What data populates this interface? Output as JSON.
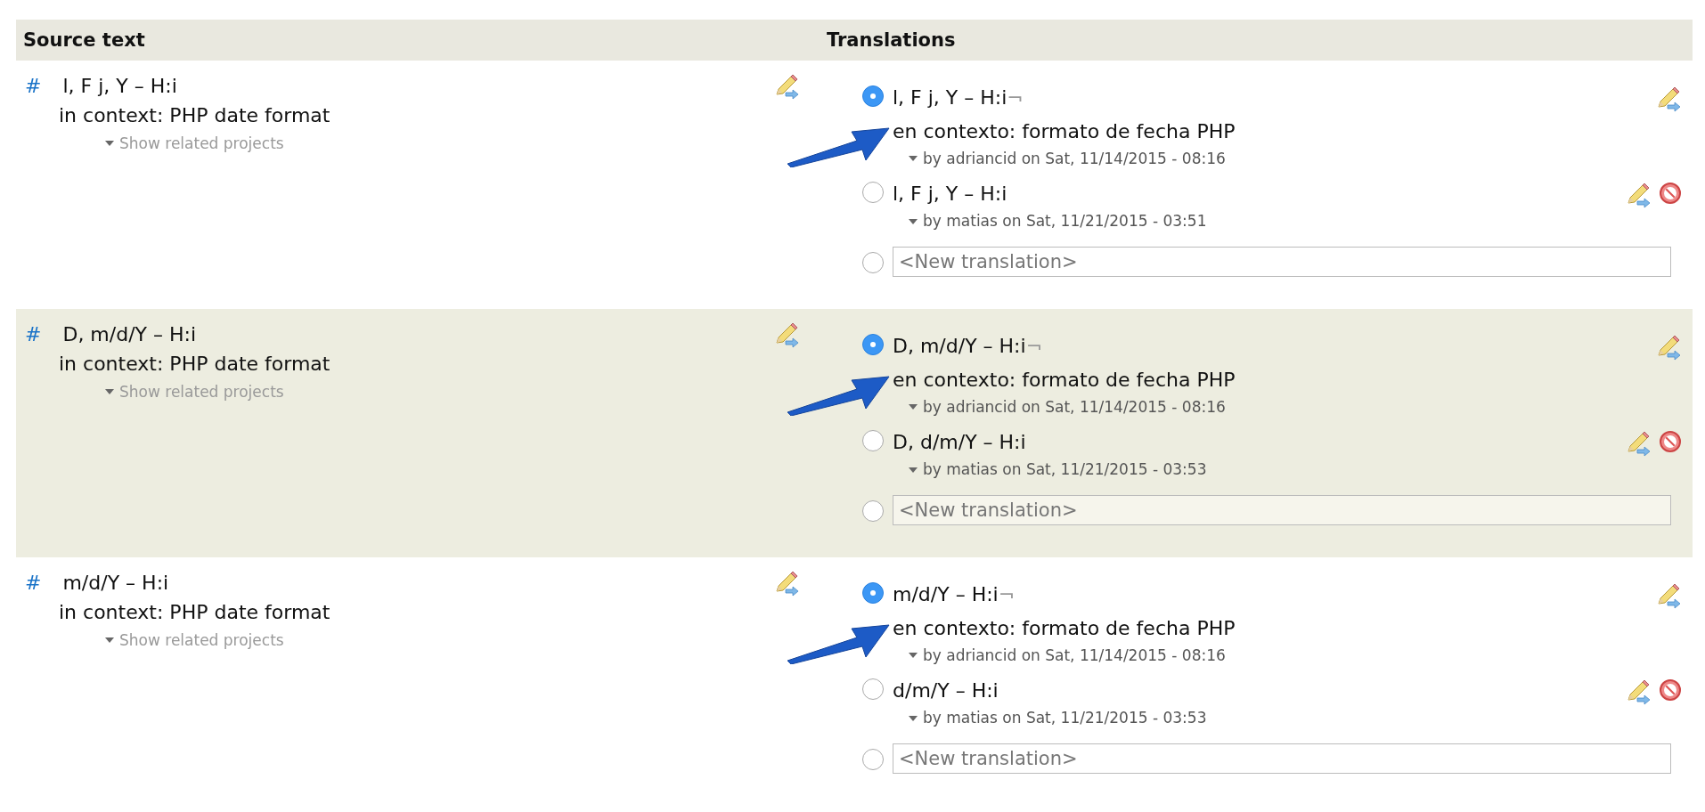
{
  "header": {
    "source_label": "Source text",
    "translations_label": "Translations"
  },
  "rows": [
    {
      "shaded": false,
      "hash": "#",
      "source": "l, F j, Y – H:i",
      "context": "in context: PHP date format",
      "related": "Show related projects",
      "translations": [
        {
          "selected": true,
          "text": "l, F j, Y – H:i",
          "end_mark": "¬",
          "context": "en contexto: formato de fecha PHP",
          "arrow": true,
          "author": "by adriancid on Sat, 11/14/2015 - 08:16",
          "can_reject": false
        },
        {
          "selected": false,
          "text": "l, F j, Y – H:i",
          "author": "by matias on Sat, 11/21/2015 - 03:51",
          "can_reject": true
        }
      ],
      "new_translation": {
        "selected": false,
        "placeholder": "<New translation>"
      }
    },
    {
      "shaded": true,
      "hash": "#",
      "source": "D, m/d/Y – H:i",
      "context": "in context: PHP date format",
      "related": "Show related projects",
      "translations": [
        {
          "selected": true,
          "text": "D, m/d/Y – H:i",
          "end_mark": "¬",
          "context": "en contexto: formato de fecha PHP",
          "arrow": true,
          "author": "by adriancid on Sat, 11/14/2015 - 08:16",
          "can_reject": false
        },
        {
          "selected": false,
          "text": "D, d/m/Y – H:i",
          "author": "by matias on Sat, 11/21/2015 - 03:53",
          "can_reject": true
        }
      ],
      "new_translation": {
        "selected": false,
        "placeholder": "<New translation>"
      }
    },
    {
      "shaded": false,
      "hash": "#",
      "source": "m/d/Y – H:i",
      "context": "in context: PHP date format",
      "related": "Show related projects",
      "translations": [
        {
          "selected": true,
          "text": "m/d/Y – H:i",
          "end_mark": "¬",
          "context": "en contexto: formato de fecha PHP",
          "arrow": true,
          "author": "by adriancid on Sat, 11/14/2015 - 08:16",
          "can_reject": false
        },
        {
          "selected": false,
          "text": "d/m/Y – H:i",
          "author": "by matias on Sat, 11/21/2015 - 03:53",
          "can_reject": true
        }
      ],
      "new_translation": {
        "selected": false,
        "placeholder": "<New translation>"
      }
    }
  ]
}
